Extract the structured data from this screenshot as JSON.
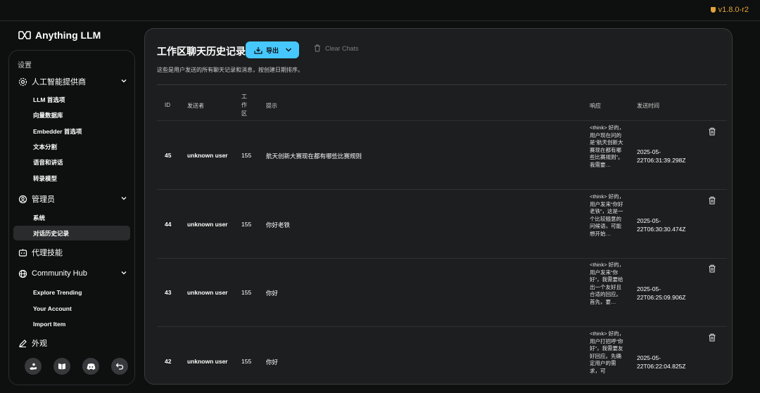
{
  "app": {
    "version": "v1.8.0-r2",
    "brand": "Anything LLM"
  },
  "sidebar": {
    "title": "设置",
    "groups": [
      {
        "label": "人工智能提供商",
        "icon": "gear-icon"
      },
      {
        "label": "管理员",
        "icon": "admin-icon"
      },
      {
        "label": "代理技能",
        "icon": "agent-icon"
      },
      {
        "label": "Community Hub",
        "icon": "globe-icon"
      },
      {
        "label": "外观",
        "icon": "brush-icon"
      }
    ],
    "ai_items": [
      "LLM 首选项",
      "向量数据库",
      "Embedder 首选项",
      "文本分割",
      "语音和讲话",
      "转录模型"
    ],
    "admin_items": [
      "系统",
      "对话历史记录"
    ],
    "hub_items": [
      "Explore Trending",
      "Your Account",
      "Import Item"
    ],
    "footer_icons": [
      "support-icon",
      "docs-icon",
      "discord-icon",
      "back-icon"
    ]
  },
  "main": {
    "title": "工作区聊天历史记录",
    "export_label": "导出",
    "clear_label": "Clear Chats",
    "subtitle": "这些是用户发送的所有聊天记录和消息，按创建日期排序。",
    "headers": {
      "id": "ID",
      "sender": "发送者",
      "workspace": "工作区",
      "prompt": "提示",
      "response": "响应",
      "sent_at": "发送时间"
    },
    "rows": [
      {
        "id": "45",
        "sender": "unknown user",
        "workspace": "155",
        "prompt": "航天创新大赛现在都有哪些比赛规则",
        "response": "<think> 好的，用户现在问的是“航天创新大赛现在都有哪些比赛规则”。我需要…",
        "sent_at": "2025-05-22T06:31:39.298Z"
      },
      {
        "id": "44",
        "sender": "unknown user",
        "workspace": "155",
        "prompt": "你好老铁",
        "response": "<think> 好的，用户发来“你好老铁”，这是一个比较随意的问候语，可能想开始…",
        "sent_at": "2025-05-22T06:30:30.474Z"
      },
      {
        "id": "43",
        "sender": "unknown user",
        "workspace": "155",
        "prompt": "你好",
        "response": "<think> 好的，用户发来“你好”，我需要给出一个友好且合适的回应。首先，要…",
        "sent_at": "2025-05-22T06:25:09.906Z"
      },
      {
        "id": "42",
        "sender": "unknown user",
        "workspace": "155",
        "prompt": "你好",
        "response": "<think> 好的，用户打招呼“你好”，我需要友好回应。先确定用户的需求，可",
        "sent_at": "2025-05-22T06:22:04.825Z"
      }
    ]
  }
}
